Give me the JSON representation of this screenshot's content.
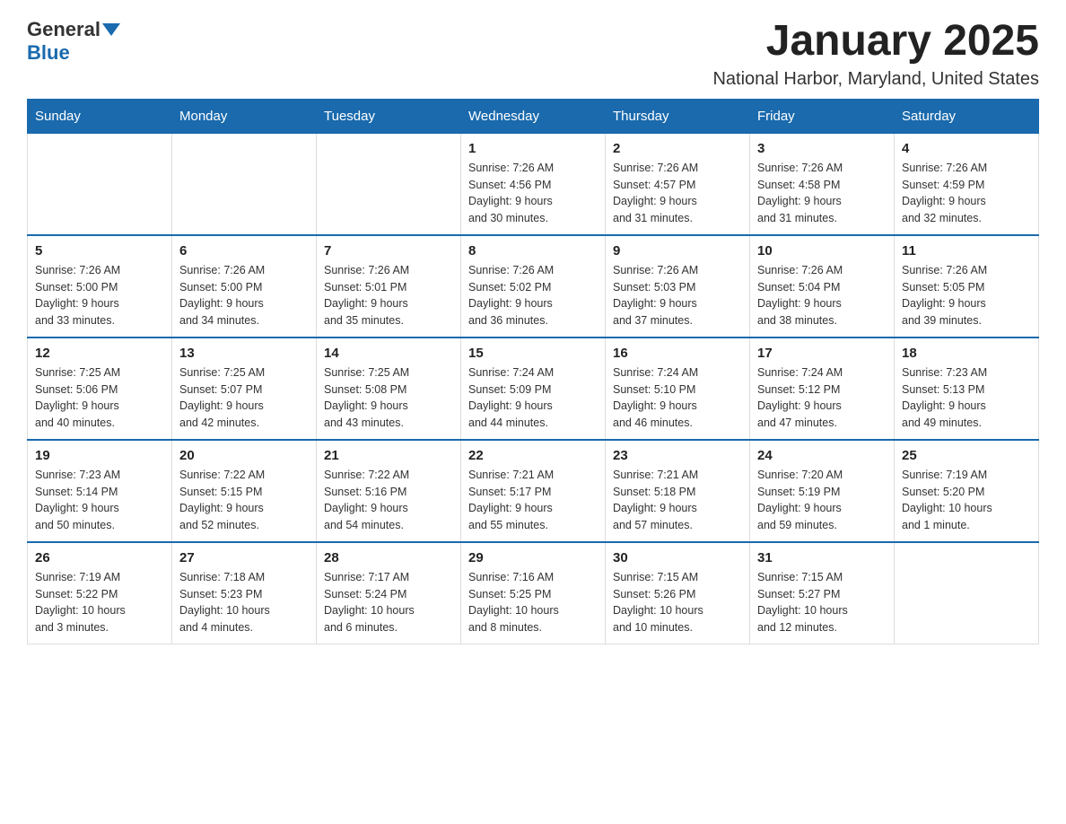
{
  "header": {
    "logo_general": "General",
    "logo_blue": "Blue",
    "month_title": "January 2025",
    "location": "National Harbor, Maryland, United States"
  },
  "weekdays": [
    "Sunday",
    "Monday",
    "Tuesday",
    "Wednesday",
    "Thursday",
    "Friday",
    "Saturday"
  ],
  "weeks": [
    [
      {
        "day": "",
        "info": ""
      },
      {
        "day": "",
        "info": ""
      },
      {
        "day": "",
        "info": ""
      },
      {
        "day": "1",
        "info": "Sunrise: 7:26 AM\nSunset: 4:56 PM\nDaylight: 9 hours\nand 30 minutes."
      },
      {
        "day": "2",
        "info": "Sunrise: 7:26 AM\nSunset: 4:57 PM\nDaylight: 9 hours\nand 31 minutes."
      },
      {
        "day": "3",
        "info": "Sunrise: 7:26 AM\nSunset: 4:58 PM\nDaylight: 9 hours\nand 31 minutes."
      },
      {
        "day": "4",
        "info": "Sunrise: 7:26 AM\nSunset: 4:59 PM\nDaylight: 9 hours\nand 32 minutes."
      }
    ],
    [
      {
        "day": "5",
        "info": "Sunrise: 7:26 AM\nSunset: 5:00 PM\nDaylight: 9 hours\nand 33 minutes."
      },
      {
        "day": "6",
        "info": "Sunrise: 7:26 AM\nSunset: 5:00 PM\nDaylight: 9 hours\nand 34 minutes."
      },
      {
        "day": "7",
        "info": "Sunrise: 7:26 AM\nSunset: 5:01 PM\nDaylight: 9 hours\nand 35 minutes."
      },
      {
        "day": "8",
        "info": "Sunrise: 7:26 AM\nSunset: 5:02 PM\nDaylight: 9 hours\nand 36 minutes."
      },
      {
        "day": "9",
        "info": "Sunrise: 7:26 AM\nSunset: 5:03 PM\nDaylight: 9 hours\nand 37 minutes."
      },
      {
        "day": "10",
        "info": "Sunrise: 7:26 AM\nSunset: 5:04 PM\nDaylight: 9 hours\nand 38 minutes."
      },
      {
        "day": "11",
        "info": "Sunrise: 7:26 AM\nSunset: 5:05 PM\nDaylight: 9 hours\nand 39 minutes."
      }
    ],
    [
      {
        "day": "12",
        "info": "Sunrise: 7:25 AM\nSunset: 5:06 PM\nDaylight: 9 hours\nand 40 minutes."
      },
      {
        "day": "13",
        "info": "Sunrise: 7:25 AM\nSunset: 5:07 PM\nDaylight: 9 hours\nand 42 minutes."
      },
      {
        "day": "14",
        "info": "Sunrise: 7:25 AM\nSunset: 5:08 PM\nDaylight: 9 hours\nand 43 minutes."
      },
      {
        "day": "15",
        "info": "Sunrise: 7:24 AM\nSunset: 5:09 PM\nDaylight: 9 hours\nand 44 minutes."
      },
      {
        "day": "16",
        "info": "Sunrise: 7:24 AM\nSunset: 5:10 PM\nDaylight: 9 hours\nand 46 minutes."
      },
      {
        "day": "17",
        "info": "Sunrise: 7:24 AM\nSunset: 5:12 PM\nDaylight: 9 hours\nand 47 minutes."
      },
      {
        "day": "18",
        "info": "Sunrise: 7:23 AM\nSunset: 5:13 PM\nDaylight: 9 hours\nand 49 minutes."
      }
    ],
    [
      {
        "day": "19",
        "info": "Sunrise: 7:23 AM\nSunset: 5:14 PM\nDaylight: 9 hours\nand 50 minutes."
      },
      {
        "day": "20",
        "info": "Sunrise: 7:22 AM\nSunset: 5:15 PM\nDaylight: 9 hours\nand 52 minutes."
      },
      {
        "day": "21",
        "info": "Sunrise: 7:22 AM\nSunset: 5:16 PM\nDaylight: 9 hours\nand 54 minutes."
      },
      {
        "day": "22",
        "info": "Sunrise: 7:21 AM\nSunset: 5:17 PM\nDaylight: 9 hours\nand 55 minutes."
      },
      {
        "day": "23",
        "info": "Sunrise: 7:21 AM\nSunset: 5:18 PM\nDaylight: 9 hours\nand 57 minutes."
      },
      {
        "day": "24",
        "info": "Sunrise: 7:20 AM\nSunset: 5:19 PM\nDaylight: 9 hours\nand 59 minutes."
      },
      {
        "day": "25",
        "info": "Sunrise: 7:19 AM\nSunset: 5:20 PM\nDaylight: 10 hours\nand 1 minute."
      }
    ],
    [
      {
        "day": "26",
        "info": "Sunrise: 7:19 AM\nSunset: 5:22 PM\nDaylight: 10 hours\nand 3 minutes."
      },
      {
        "day": "27",
        "info": "Sunrise: 7:18 AM\nSunset: 5:23 PM\nDaylight: 10 hours\nand 4 minutes."
      },
      {
        "day": "28",
        "info": "Sunrise: 7:17 AM\nSunset: 5:24 PM\nDaylight: 10 hours\nand 6 minutes."
      },
      {
        "day": "29",
        "info": "Sunrise: 7:16 AM\nSunset: 5:25 PM\nDaylight: 10 hours\nand 8 minutes."
      },
      {
        "day": "30",
        "info": "Sunrise: 7:15 AM\nSunset: 5:26 PM\nDaylight: 10 hours\nand 10 minutes."
      },
      {
        "day": "31",
        "info": "Sunrise: 7:15 AM\nSunset: 5:27 PM\nDaylight: 10 hours\nand 12 minutes."
      },
      {
        "day": "",
        "info": ""
      }
    ]
  ]
}
